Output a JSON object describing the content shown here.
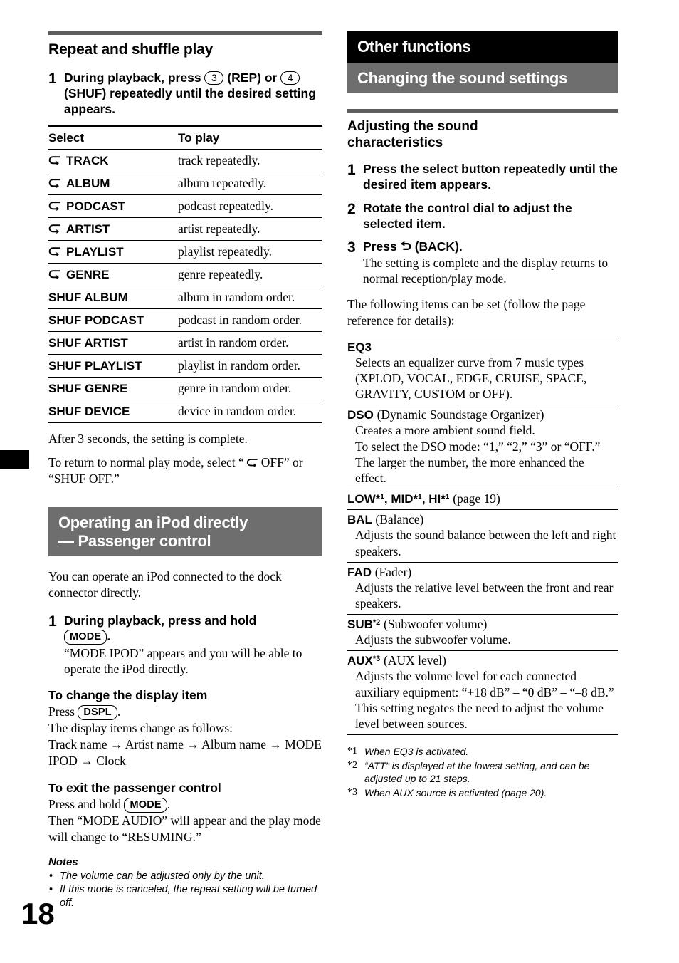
{
  "page": {
    "folio": "18"
  },
  "left": {
    "section_title": "Repeat and shuffle play",
    "step1": {
      "num": "1",
      "text_a": "During playback, press",
      "chip1": "3",
      "text_b": "(REP) or",
      "chip2": "4",
      "text_c": "(SHUF) repeatedly until the desired setting appears."
    },
    "table": {
      "headers": [
        "Select",
        "To play"
      ],
      "rows": [
        {
          "icon": "repeat-loop-icon",
          "select": "TRACK",
          "play": "track repeatedly."
        },
        {
          "icon": "repeat-loop-icon",
          "select": "ALBUM",
          "play": "album repeatedly."
        },
        {
          "icon": "repeat-loop-icon",
          "select": "PODCAST",
          "play": "podcast repeatedly."
        },
        {
          "icon": "repeat-loop-icon",
          "select": "ARTIST",
          "play": "artist repeatedly."
        },
        {
          "icon": "repeat-loop-icon",
          "select": "PLAYLIST",
          "play": "playlist repeatedly."
        },
        {
          "icon": "repeat-loop-icon",
          "select": "GENRE",
          "play": "genre repeatedly."
        },
        {
          "icon": null,
          "select": "SHUF ALBUM",
          "play": "album in random order."
        },
        {
          "icon": null,
          "select": "SHUF PODCAST",
          "play": "podcast in random order."
        },
        {
          "icon": null,
          "select": "SHUF ARTIST",
          "play": "artist in random order."
        },
        {
          "icon": null,
          "select": "SHUF PLAYLIST",
          "play": "playlist in random order."
        },
        {
          "icon": null,
          "select": "SHUF GENRE",
          "play": "genre in random order."
        },
        {
          "icon": null,
          "select": "SHUF DEVICE",
          "play": "device in random order."
        }
      ]
    },
    "after_table": "After 3 seconds, the setting is complete.",
    "return_normal_a": "To return to normal play mode, select “",
    "return_normal_b": "OFF” or “SHUF OFF.”",
    "banner_line1": "Operating an iPod directly",
    "banner_line2": "— Passenger control",
    "intro": "You can operate an iPod connected to the dock connector directly.",
    "step_ipod": {
      "num": "1",
      "head_a": "During playback, press and hold",
      "chip": "MODE",
      "head_b": ".",
      "sub": "“MODE IPOD” appears and you will be able to operate the iPod directly."
    },
    "display_item": {
      "head": "To change the display item",
      "press_label": "Press",
      "chip": "DSPL",
      "press_tail": ".",
      "line2": "The display items change as follows:",
      "sequence": "Track name → Artist name → Album name → MODE IPOD → Clock"
    },
    "exit_passenger": {
      "head": "To exit the passenger control",
      "press_label": "Press and hold",
      "chip": "MODE",
      "press_tail": ".",
      "line2": "Then “MODE AUDIO” will appear and the play mode will change to “RESUMING.”"
    },
    "notes": {
      "title": "Notes",
      "items": [
        "The volume can be adjusted only by the unit.",
        "If this mode is canceled, the repeat setting will be turned off."
      ]
    }
  },
  "right": {
    "banner_black": "Other functions",
    "banner_gray": "Changing the sound settings",
    "subhead_line1": "Adjusting the sound",
    "subhead_line2": "characteristics",
    "steps": [
      {
        "num": "1",
        "head": "Press the select button repeatedly until the desired item appears.",
        "sub": ""
      },
      {
        "num": "2",
        "head": "Rotate the control dial to adjust the selected item.",
        "sub": ""
      },
      {
        "num": "3",
        "head_a": "Press",
        "icon": "back-arrow-icon",
        "head_b": "(BACK).",
        "sub": "The setting is complete and the display returns to normal reception/play mode."
      }
    ],
    "intro": "The following items can be set (follow the page reference for details):",
    "settings": [
      {
        "term": "EQ3",
        "term_paren": "",
        "sup": "",
        "desc": "Selects an equalizer curve from 7 music types (XPLOD, VOCAL, EDGE, CRUISE, SPACE, GRAVITY, CUSTOM or OFF)."
      },
      {
        "term": "DSO",
        "term_paren": "(Dynamic Soundstage Organizer)",
        "sup": "",
        "desc": "Creates a more ambient sound field.\nTo select the DSO mode: “1,” “2,” “3” or “OFF.”\nThe larger the number, the more enhanced the effect."
      },
      {
        "term": "LOW*¹, MID*¹, HI*¹",
        "term_paren": "(page 19)",
        "sup": "",
        "desc": ""
      },
      {
        "term": "BAL",
        "term_paren": "(Balance)",
        "sup": "",
        "desc": "Adjusts the sound balance between the left and right speakers."
      },
      {
        "term": "FAD",
        "term_paren": "(Fader)",
        "sup": "",
        "desc": "Adjusts the relative level between the front and rear speakers."
      },
      {
        "term": "SUB",
        "term_paren": "(Subwoofer volume)",
        "sup": "*2",
        "desc": "Adjusts the subwoofer volume."
      },
      {
        "term": "AUX",
        "term_paren": "(AUX level)",
        "sup": "*3",
        "desc": "Adjusts the volume level for each connected auxiliary equipment: “+18 dB” – “0 dB” – “–8 dB.”\nThis setting negates the need to adjust the volume level between sources."
      }
    ],
    "footnotes": [
      {
        "mark": "*1",
        "text": "When EQ3 is activated."
      },
      {
        "mark": "*2",
        "text": "“ATT” is displayed at the lowest setting, and can be adjusted up to 21 steps."
      },
      {
        "mark": "*3",
        "text": "When AUX source is activated (page 20)."
      }
    ]
  }
}
